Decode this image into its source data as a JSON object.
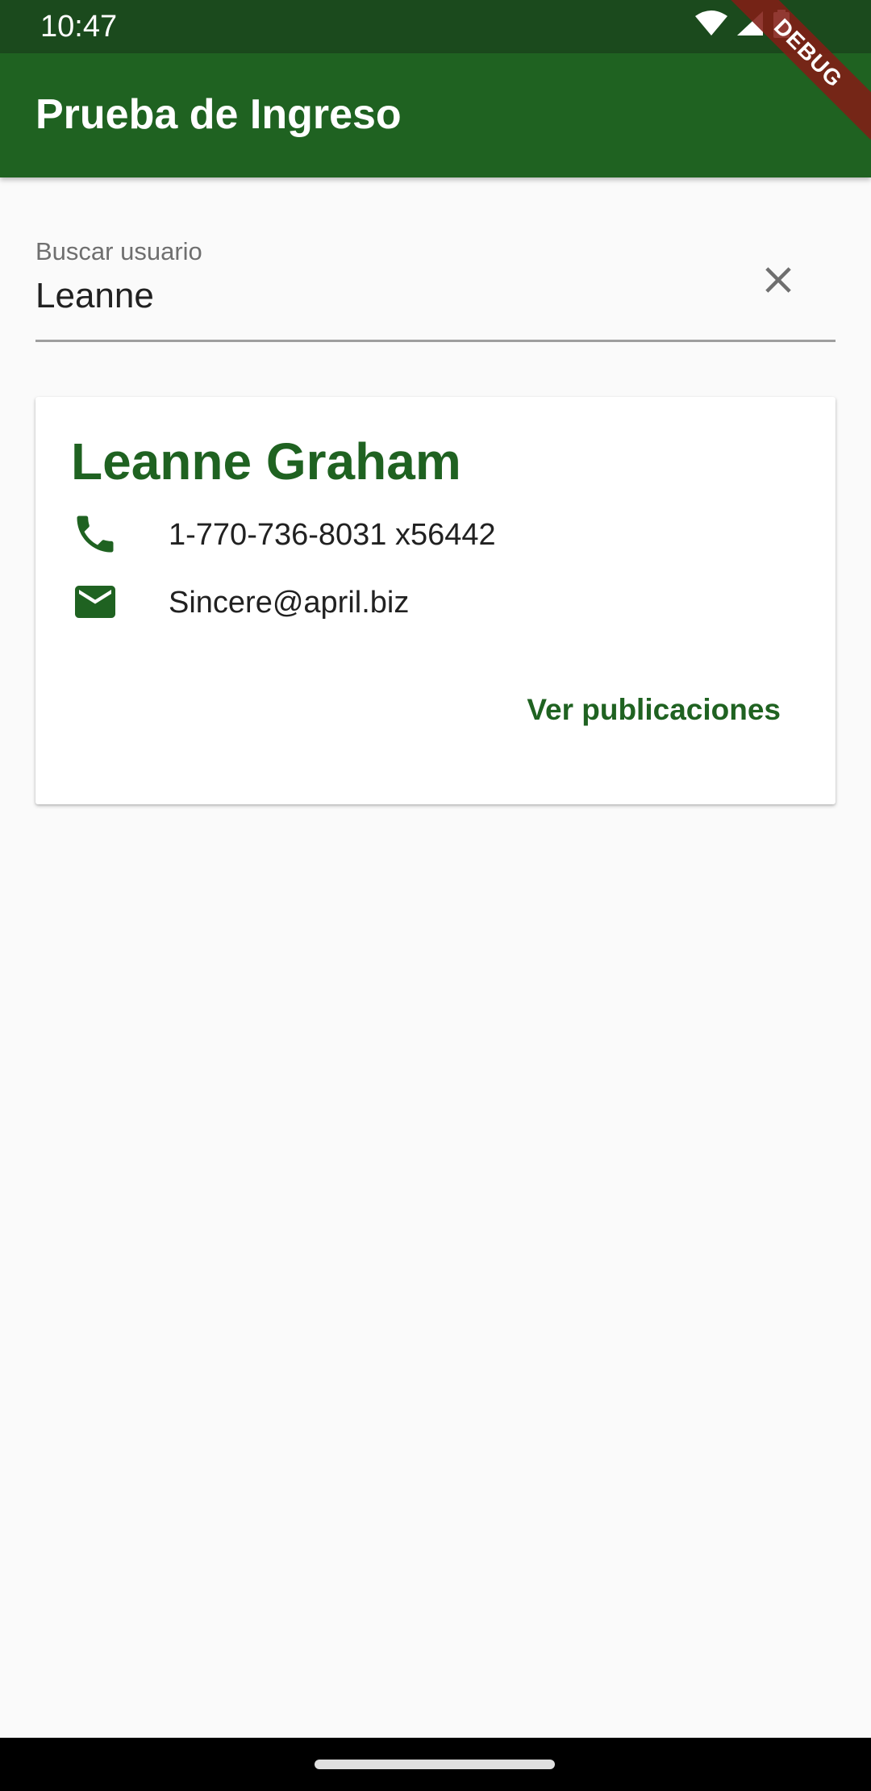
{
  "status_bar": {
    "time": "10:47",
    "icons": [
      "wifi-icon",
      "cellular-signal-icon",
      "battery-icon"
    ]
  },
  "debug_banner": "DEBUG",
  "app_bar": {
    "title": "Prueba de Ingreso"
  },
  "search": {
    "label": "Buscar usuario",
    "value": "Leanne",
    "clear_icon": "close-icon"
  },
  "results": [
    {
      "name": "Leanne Graham",
      "phone": "1-770-736-8031 x56442",
      "email": "Sincere@april.biz",
      "action_label": "Ver publicaciones"
    }
  ],
  "colors": {
    "primary": "#1f6221",
    "primary_dark": "#1b4a1d",
    "background": "#fafafa",
    "card": "#ffffff",
    "debug_ribbon": "#821e16"
  }
}
